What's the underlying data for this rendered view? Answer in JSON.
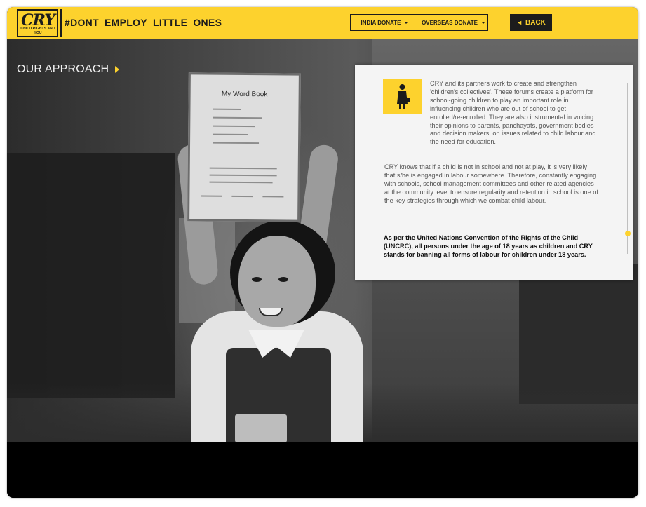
{
  "logo": {
    "mark": "CRY",
    "subtitle": "CHILD RIGHTS AND YOU"
  },
  "header": {
    "hashtag": "#DONT_EMPLOY_LITTLE_ONES",
    "india_donate": "INDIA DONATE",
    "overseas_donate": "OVERSEAS DONATE",
    "back": "BACK"
  },
  "section": {
    "title": "OUR APPROACH"
  },
  "book": {
    "title": "My Word Book"
  },
  "panel": {
    "paragraph_1": "CRY and its partners work to create and strengthen 'children's collectives'. These forums create a platform for school-going children to play an important role in influencing children who are out of school to get enrolled/re-enrolled. They are also instrumental in voicing their opinions to parents, panchayats, government bodies and decision makers, on issues related to child labour and the need for education.",
    "paragraph_2": "CRY knows that if a child is not in school and not at play, it is very likely that s/he is engaged in labour somewhere. Therefore, constantly engaging with schools, school management committees and other related agencies at the community level to ensure regularity and retention in school is one of the key strategies through which we combat child labour.",
    "paragraph_3": "As per the United Nations Convention of the Rights of the Child (UNCRC),  all persons under the age of 18 years as children and CRY stands for banning all forms of labour for children under 18 years.",
    "scroll_position": 0.88
  },
  "icons": {
    "panel_icon": "girl-student-icon",
    "dropdown": "caret-down-icon",
    "back": "arrow-left-icon",
    "section": "arrow-right-icon"
  },
  "colors": {
    "brand_yellow": "#fdd22d",
    "dark": "#1c1c1c",
    "panel_bg": "#f4f4f4"
  }
}
